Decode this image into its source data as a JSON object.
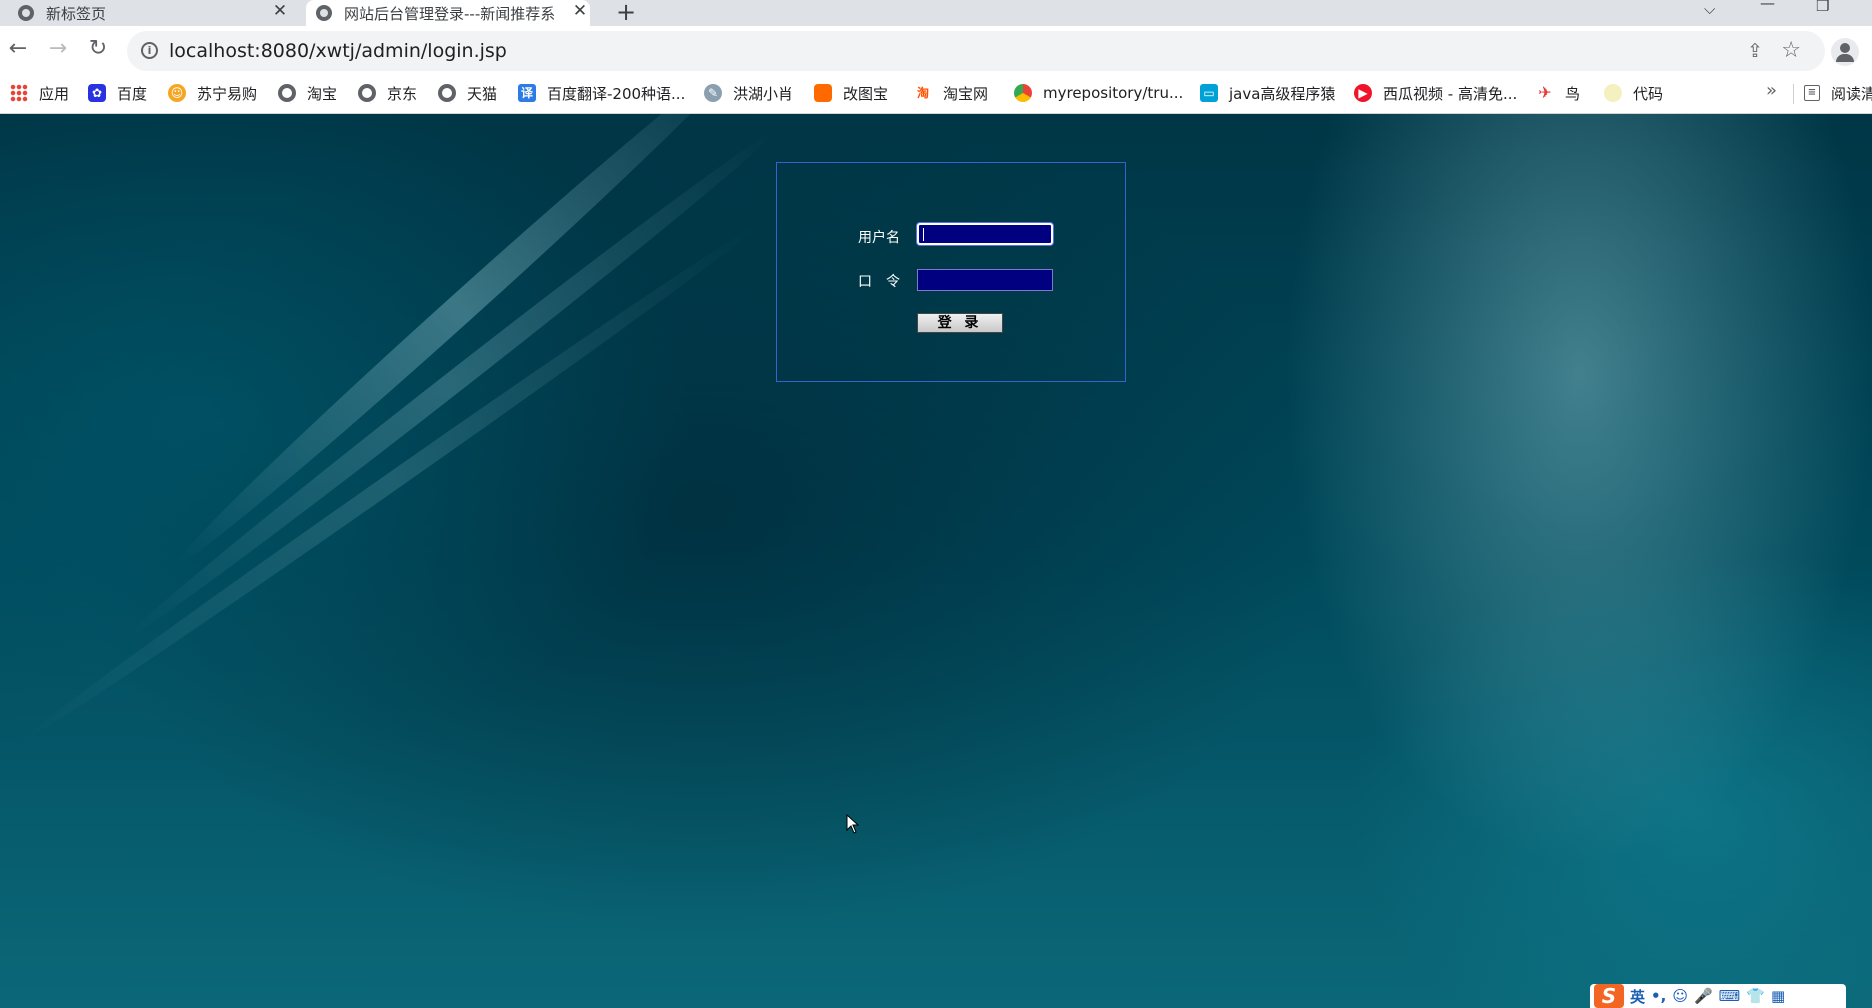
{
  "tabs": [
    {
      "title": "新标签页",
      "close": "✕"
    },
    {
      "title": "网站后台管理登录---新闻推荐系",
      "close": "✕"
    }
  ],
  "new_tab": "+",
  "window_controls": {
    "dropdown": "⌵",
    "minimize": "—",
    "restore": "❐"
  },
  "address_bar": {
    "url": "localhost:8080/xwtj/admin/login.jsp"
  },
  "bookmarks": [
    {
      "label": "应用",
      "icon": "apps-grid-icon"
    },
    {
      "label": "百度",
      "icon": "baidu-paw-icon"
    },
    {
      "label": "苏宁易购",
      "icon": "suning-icon"
    },
    {
      "label": "淘宝",
      "icon": "globe-icon"
    },
    {
      "label": "京东",
      "icon": "globe-icon"
    },
    {
      "label": "天猫",
      "icon": "globe-icon"
    },
    {
      "label": "百度翻译-200种语...",
      "icon": "baidu-translate-icon"
    },
    {
      "label": "洪湖小肖",
      "icon": "hongxiao-icon"
    },
    {
      "label": "改图宝",
      "icon": "gaitubao-icon"
    },
    {
      "label": "淘宝网",
      "icon": "taobao-icon"
    },
    {
      "label": "myrepository/tru...",
      "icon": "chrome-icon"
    },
    {
      "label": "java高级程序猿",
      "icon": "bilibili-icon"
    },
    {
      "label": "西瓜视频 - 高清免...",
      "icon": "xigua-icon"
    },
    {
      "label": "鸟",
      "icon": "bird-icon"
    },
    {
      "label": "代码",
      "icon": "code-icon"
    }
  ],
  "bookmarks_more": "»",
  "reading_list": "阅读清",
  "login": {
    "username_label": "用户名",
    "password_label": "口　令",
    "submit_label": "登 录"
  },
  "ime": {
    "logo": "S",
    "mode": "英",
    "punct": "•,",
    "items": [
      "☺",
      "🎤",
      "⌨",
      "👕",
      "▦"
    ]
  },
  "colors": {
    "input_bg": "#000080",
    "box_border": "#3d5fd0",
    "page_bg": "#003848"
  }
}
